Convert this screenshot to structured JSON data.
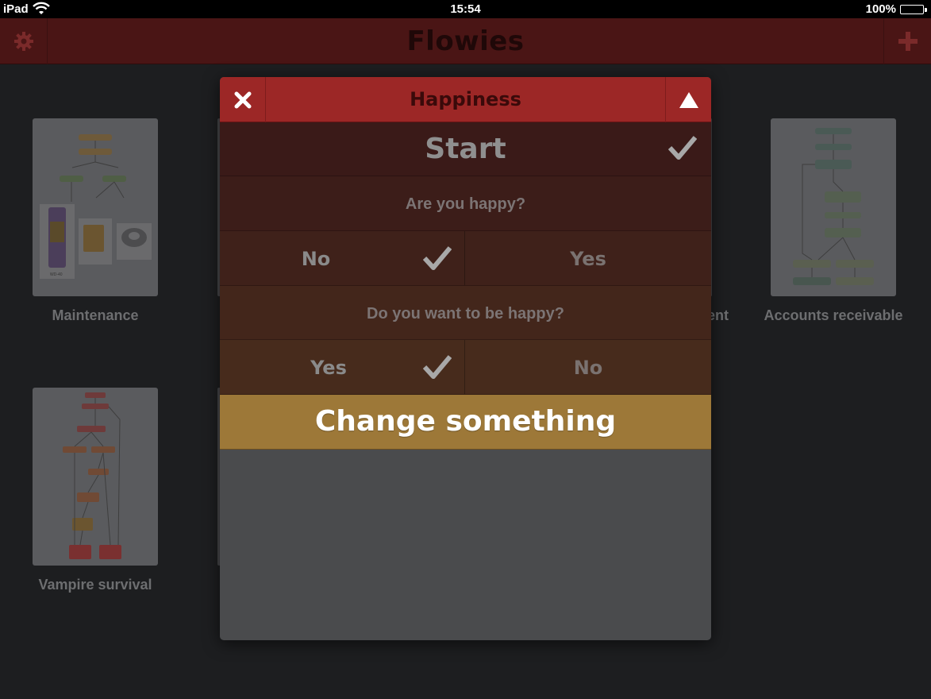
{
  "status_bar": {
    "device": "iPad",
    "time": "15:54",
    "battery": "100%"
  },
  "nav": {
    "title": "Flowies",
    "settings_icon": "gear-icon",
    "add_icon": "plus-icon"
  },
  "grid": {
    "cards": [
      {
        "label": "Maintenance"
      },
      {
        "label": "Accounts receivable"
      },
      {
        "label": "Vampire survival"
      }
    ],
    "partial_label": "ent"
  },
  "thumb_text": {
    "start": "Start",
    "wd40": "WD-40",
    "no_problem": "No problem!",
    "duct_tape": "Duct tape",
    "end": "End",
    "wd40_caption": "WD-40"
  },
  "modal": {
    "title": "Happiness",
    "close_icon": "close-icon",
    "collapse_icon": "triangle-up-icon",
    "start": "Start",
    "q1": "Are you happy?",
    "q1_left": "No",
    "q1_right": "Yes",
    "q2": "Do you want to be happy?",
    "q2_left": "Yes",
    "q2_right": "No",
    "result": "Change something"
  },
  "colors": {
    "nav_bg": "#4a1515",
    "modal_header": "#9c2726",
    "result_bg": "#9d7838",
    "check": "#b5b5b5"
  }
}
